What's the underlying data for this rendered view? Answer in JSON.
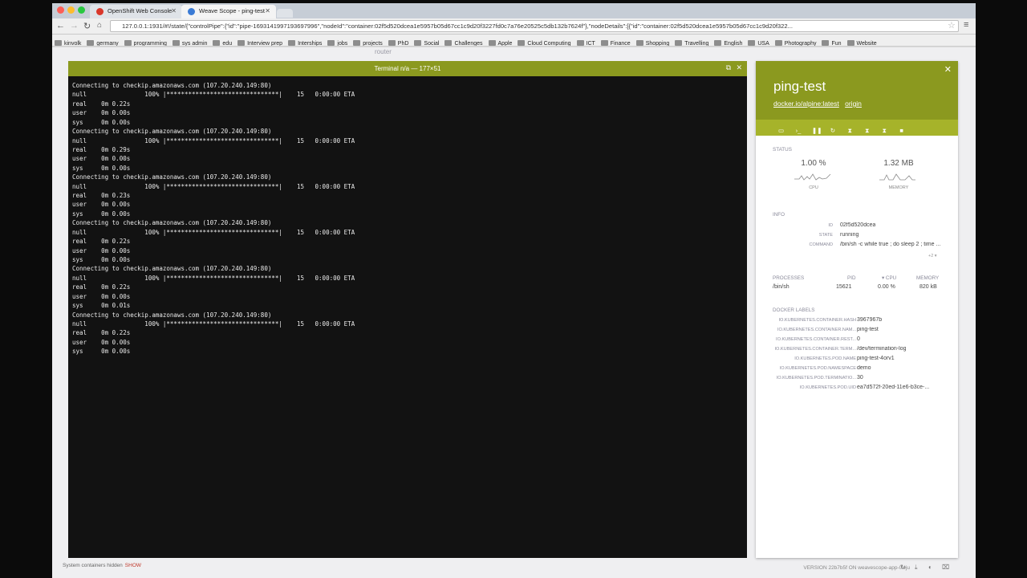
{
  "browser": {
    "tabs": [
      {
        "title": "OpenShift Web Console",
        "favicon_color": "#d9372b",
        "active": false
      },
      {
        "title": "Weave Scope - ping-test",
        "favicon_color": "#3a7bd5",
        "active": true
      }
    ],
    "url": "127.0.0.1:1931/#!/state/{\"controlPipe\":{\"id\":\"pipe-1693141997193697996\",\"nodeId\":\"container:02f5d520dcea1e5957b05d67cc1c9d20f3227fd0c7a76e20525c5db132b7624f\"},\"nodeDetails\":[{\"id\":\"container:02f5d520dcea1e5957b05d67cc1c9d20f322...",
    "bookmarks": [
      "kinvolk",
      "germany",
      "programming",
      "sys admin",
      "edu",
      "Interview prep",
      "Interships",
      "jobs",
      "projects",
      "PhD",
      "Social",
      "Challenges",
      "Apple",
      "Cloud Computing",
      "ICT",
      "Finance",
      "Shopping",
      "Travelling",
      "English",
      "USA",
      "Photography",
      "Fun",
      "Website"
    ]
  },
  "background": {
    "router_label": "router"
  },
  "terminal": {
    "title": "Terminal n/a — 177×51",
    "lines": [
      "Connecting to checkip.amazonaws.com (107.20.240.149:80)",
      "null                100% |*******************************|    15   0:00:00 ETA",
      "real    0m 0.22s",
      "user    0m 0.00s",
      "sys     0m 0.00s",
      "Connecting to checkip.amazonaws.com (107.20.240.149:80)",
      "null                100% |*******************************|    15   0:00:00 ETA",
      "real    0m 0.29s",
      "user    0m 0.00s",
      "sys     0m 0.00s",
      "Connecting to checkip.amazonaws.com (107.20.240.149:80)",
      "null                100% |*******************************|    15   0:00:00 ETA",
      "real    0m 0.23s",
      "user    0m 0.00s",
      "sys     0m 0.00s",
      "Connecting to checkip.amazonaws.com (107.20.240.149:80)",
      "null                100% |*******************************|    15   0:00:00 ETA",
      "real    0m 0.22s",
      "user    0m 0.00s",
      "sys     0m 0.00s",
      "Connecting to checkip.amazonaws.com (107.20.240.149:80)",
      "null                100% |*******************************|    15   0:00:00 ETA",
      "real    0m 0.22s",
      "user    0m 0.00s",
      "sys     0m 0.01s",
      "Connecting to checkip.amazonaws.com (107.20.240.149:80)",
      "null                100% |*******************************|    15   0:00:00 ETA",
      "real    0m 0.22s",
      "user    0m 0.00s",
      "sys     0m 0.00s"
    ]
  },
  "details": {
    "title": "ping-test",
    "image_link": "docker.io/alpine:latest",
    "origin_link": "origin",
    "accent_color": "#8b991f",
    "status_label": "STATUS",
    "cpu_value": "1.00 %",
    "cpu_label": "CPU",
    "memory_value": "1.32 MB",
    "memory_label": "MEMORY",
    "info_label": "INFO",
    "info": [
      {
        "key": "ID",
        "value": "02f5d520dcea"
      },
      {
        "key": "STATE",
        "value": "running"
      },
      {
        "key": "COMMAND",
        "value": "/bin/sh -c while true ; do sleep 2 ; time ..."
      }
    ],
    "more_link": "+2 ▾",
    "processes_label": "PROCESSES",
    "processes_header": {
      "pid": "PID",
      "cpu": "▾ CPU",
      "memory": "MEMORY"
    },
    "processes": [
      {
        "name": "/bin/sh",
        "pid": "15621",
        "cpu": "0.00 %",
        "memory": "820 kB"
      }
    ],
    "docker_labels_label": "DOCKER LABELS",
    "docker_labels": [
      {
        "key": "IO.KUBERNETES.CONTAINER.HASH",
        "value": "3967967b"
      },
      {
        "key": "IO.KUBERNETES.CONTAINER.NAM...",
        "value": "ping-test"
      },
      {
        "key": "IO.KUBERNETES.CONTAINER.REST...",
        "value": "0"
      },
      {
        "key": "IO.KUBERNETES.CONTAINER.TERM...",
        "value": "/dev/termination-log"
      },
      {
        "key": "IO.KUBERNETES.POD.NAME",
        "value": "ping-test-4orv1"
      },
      {
        "key": "IO.KUBERNETES.POD.NAMESPACE",
        "value": "demo"
      },
      {
        "key": "IO.KUBERNETES.POD.TERMINATIO...",
        "value": "30"
      },
      {
        "key": "IO.KUBERNETES.POD.UID",
        "value": "ea7d572f-20ed-11e6-b3ce-..."
      }
    ]
  },
  "footer": {
    "system_containers": "System containers hidden",
    "show_link": "SHOW",
    "version": "VERSION 22b7b5f ON weavescope-app-0wju"
  }
}
